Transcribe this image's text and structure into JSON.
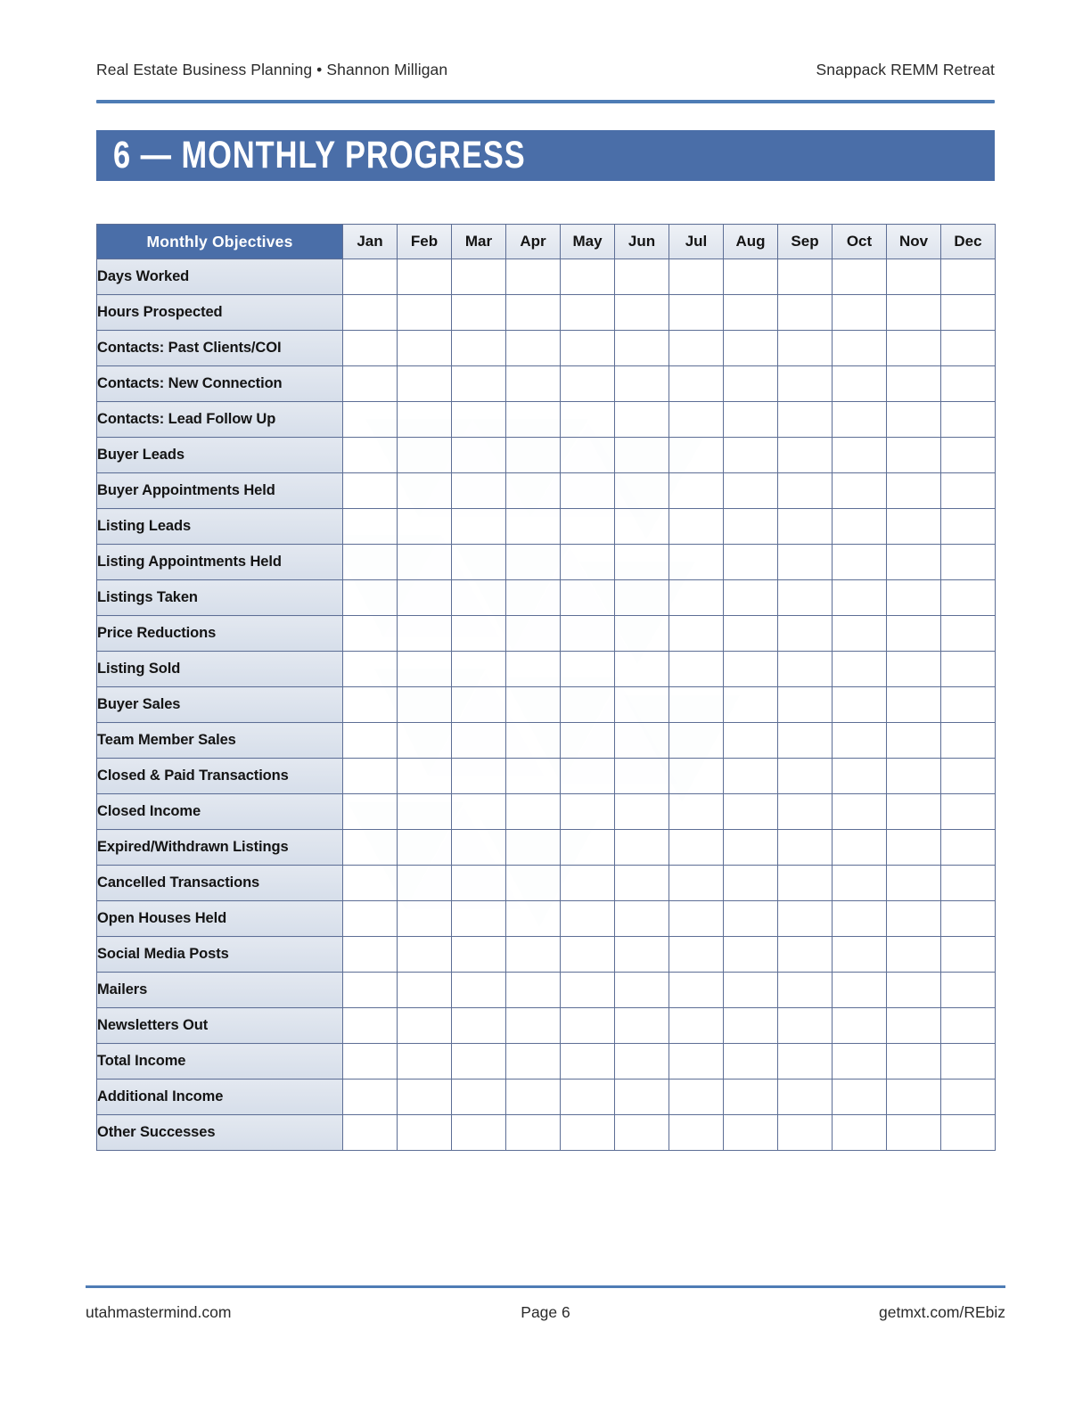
{
  "page": {
    "header": {
      "left": "Real Estate Business Planning • Shannon Milligan",
      "right": "Snappack REMM Retreat"
    },
    "section_title": "6 — MONTHLY PROGRESS",
    "footer": {
      "left": "utahmastermind.com",
      "center": "Page 6",
      "right": "getmxt.com/REbiz"
    }
  },
  "colors": {
    "accent_blue": "#4a6ea8",
    "rule_blue": "#4e7cb5",
    "grid_border": "#5d6e95",
    "objective_cell_bg": "#dde4ee",
    "month_head_bg": "#e5eaf2"
  },
  "table": {
    "corner_header": "Monthly Objectives",
    "month_headers": [
      "Jan",
      "Feb",
      "Mar",
      "Apr",
      "May",
      "Jun",
      "Jul",
      "Aug",
      "Sep",
      "Oct",
      "Nov",
      "Dec"
    ],
    "rows": [
      {
        "label": "Days Worked",
        "values": [
          "",
          "",
          "",
          "",
          "",
          "",
          "",
          "",
          "",
          "",
          "",
          ""
        ]
      },
      {
        "label": "Hours Prospected",
        "values": [
          "",
          "",
          "",
          "",
          "",
          "",
          "",
          "",
          "",
          "",
          "",
          ""
        ]
      },
      {
        "label": "Contacts: Past Clients/COI",
        "values": [
          "",
          "",
          "",
          "",
          "",
          "",
          "",
          "",
          "",
          "",
          "",
          ""
        ]
      },
      {
        "label": "Contacts: New Connection",
        "values": [
          "",
          "",
          "",
          "",
          "",
          "",
          "",
          "",
          "",
          "",
          "",
          ""
        ]
      },
      {
        "label": "Contacts: Lead Follow Up",
        "values": [
          "",
          "",
          "",
          "",
          "",
          "",
          "",
          "",
          "",
          "",
          "",
          ""
        ]
      },
      {
        "label": "Buyer Leads",
        "values": [
          "",
          "",
          "",
          "",
          "",
          "",
          "",
          "",
          "",
          "",
          "",
          ""
        ]
      },
      {
        "label": "Buyer Appointments Held",
        "values": [
          "",
          "",
          "",
          "",
          "",
          "",
          "",
          "",
          "",
          "",
          "",
          ""
        ]
      },
      {
        "label": "Listing Leads",
        "values": [
          "",
          "",
          "",
          "",
          "",
          "",
          "",
          "",
          "",
          "",
          "",
          ""
        ]
      },
      {
        "label": "Listing Appointments Held",
        "values": [
          "",
          "",
          "",
          "",
          "",
          "",
          "",
          "",
          "",
          "",
          "",
          ""
        ]
      },
      {
        "label": "Listings Taken",
        "values": [
          "",
          "",
          "",
          "",
          "",
          "",
          "",
          "",
          "",
          "",
          "",
          ""
        ]
      },
      {
        "label": "Price Reductions",
        "values": [
          "",
          "",
          "",
          "",
          "",
          "",
          "",
          "",
          "",
          "",
          "",
          ""
        ]
      },
      {
        "label": "Listing Sold",
        "values": [
          "",
          "",
          "",
          "",
          "",
          "",
          "",
          "",
          "",
          "",
          "",
          ""
        ]
      },
      {
        "label": "Buyer Sales",
        "values": [
          "",
          "",
          "",
          "",
          "",
          "",
          "",
          "",
          "",
          "",
          "",
          ""
        ]
      },
      {
        "label": "Team Member Sales",
        "values": [
          "",
          "",
          "",
          "",
          "",
          "",
          "",
          "",
          "",
          "",
          "",
          ""
        ]
      },
      {
        "label": "Closed & Paid Transactions",
        "values": [
          "",
          "",
          "",
          "",
          "",
          "",
          "",
          "",
          "",
          "",
          "",
          ""
        ]
      },
      {
        "label": "Closed Income",
        "values": [
          "",
          "",
          "",
          "",
          "",
          "",
          "",
          "",
          "",
          "",
          "",
          ""
        ]
      },
      {
        "label": "Expired/Withdrawn Listings",
        "values": [
          "",
          "",
          "",
          "",
          "",
          "",
          "",
          "",
          "",
          "",
          "",
          ""
        ]
      },
      {
        "label": "Cancelled Transactions",
        "values": [
          "",
          "",
          "",
          "",
          "",
          "",
          "",
          "",
          "",
          "",
          "",
          ""
        ]
      },
      {
        "label": "Open Houses Held",
        "values": [
          "",
          "",
          "",
          "",
          "",
          "",
          "",
          "",
          "",
          "",
          "",
          ""
        ]
      },
      {
        "label": "Social Media Posts",
        "values": [
          "",
          "",
          "",
          "",
          "",
          "",
          "",
          "",
          "",
          "",
          "",
          ""
        ]
      },
      {
        "label": "Mailers",
        "values": [
          "",
          "",
          "",
          "",
          "",
          "",
          "",
          "",
          "",
          "",
          "",
          ""
        ]
      },
      {
        "label": "Newsletters Out",
        "values": [
          "",
          "",
          "",
          "",
          "",
          "",
          "",
          "",
          "",
          "",
          "",
          ""
        ]
      },
      {
        "label": "Total Income",
        "values": [
          "",
          "",
          "",
          "",
          "",
          "",
          "",
          "",
          "",
          "",
          "",
          ""
        ]
      },
      {
        "label": "Additional Income",
        "values": [
          "",
          "",
          "",
          "",
          "",
          "",
          "",
          "",
          "",
          "",
          "",
          ""
        ]
      },
      {
        "label": "Other Successes",
        "values": [
          "",
          "",
          "",
          "",
          "",
          "",
          "",
          "",
          "",
          "",
          "",
          ""
        ]
      }
    ]
  }
}
